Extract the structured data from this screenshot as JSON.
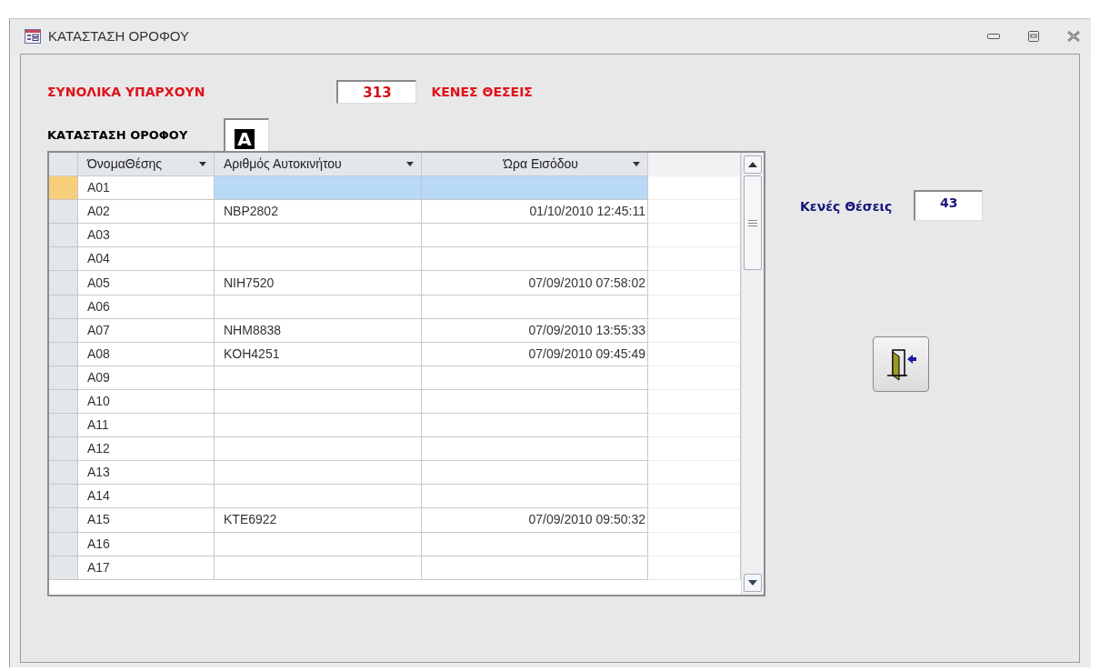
{
  "window": {
    "title": "ΚΑΤΑΣΤΑΣΗ ΟΡΟΦΟΥ"
  },
  "summary": {
    "label": "ΣΥΝΟΛΙΚΑ ΥΠΑΡΧΟΥΝ",
    "value": "313",
    "suffix": "ΚΕΝΕΣ ΘΕΣΕΙΣ"
  },
  "floor": {
    "label": "ΚΑΤΑΣΤΑΣΗ ΟΡΟΦΟΥ",
    "value": "A"
  },
  "table": {
    "columns": [
      "ΌνομαΘέσης",
      "Αριθμός Αυτοκινήτου",
      "Ώρα Εισόδου"
    ],
    "rows": [
      {
        "spot": "A01",
        "selected": true
      },
      {
        "spot": "A02",
        "plate": "NBP2802",
        "entry_time": "01/10/2010 12:45:11",
        "selected": false
      },
      {
        "spot": "A03",
        "selected": false
      },
      {
        "spot": "A04",
        "selected": false
      },
      {
        "spot": "A05",
        "plate": "NIH7520",
        "entry_time": "07/09/2010 07:58:02",
        "selected": false
      },
      {
        "spot": "A06",
        "selected": false
      },
      {
        "spot": "A07",
        "plate": "NHM8838",
        "entry_time": "07/09/2010 13:55:33",
        "selected": false
      },
      {
        "spot": "A08",
        "plate": "KOH4251",
        "entry_time": "07/09/2010 09:45:49",
        "selected": false
      },
      {
        "spot": "A09",
        "selected": false
      },
      {
        "spot": "A10",
        "selected": false
      },
      {
        "spot": "A11",
        "selected": false
      },
      {
        "spot": "A12",
        "selected": false
      },
      {
        "spot": "A13",
        "selected": false
      },
      {
        "spot": "A14",
        "selected": false
      },
      {
        "spot": "A15",
        "plate": "KTE6922",
        "entry_time": "07/09/2010 09:50:32",
        "selected": false
      },
      {
        "spot": "A16",
        "selected": false
      },
      {
        "spot": "A17",
        "selected": false
      }
    ]
  },
  "free_spots": {
    "label": "Κενές Θέσεις",
    "value": "43"
  }
}
